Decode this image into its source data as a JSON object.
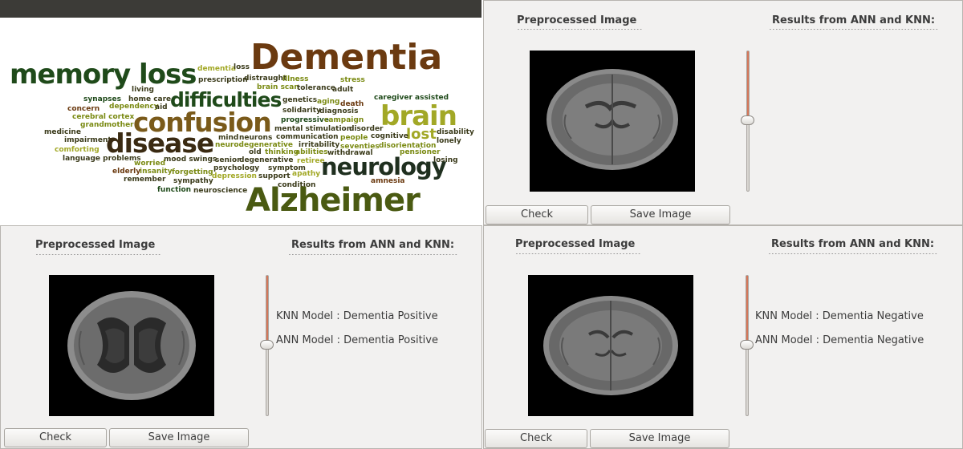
{
  "wordcloud": {
    "words": {
      "dementia": "Dementia",
      "memory_loss": "memory loss",
      "difficulties": "difficulties",
      "confusion": "confusion",
      "disease": "disease",
      "brain": "brain",
      "lost": "lost",
      "neurology": "neurology",
      "alzheimer": "Alzheimer",
      "dementia_small": "dementia",
      "loss": "loss",
      "prescription": "prescription",
      "distraught": "distraught",
      "illness": "illness",
      "stress": "stress",
      "brain_scan": "brain scan",
      "tolerance": "tolerance",
      "adult": "adult",
      "living": "living",
      "synapses": "synapses",
      "home_care": "home care",
      "caregiver_assisted": "caregiver assisted",
      "genetics": "genetics",
      "aging": "aging",
      "death": "death",
      "concern": "concern",
      "dependency": "dependency",
      "aid": "aid",
      "cerebral_cortex": "cerebral cortex",
      "solidarity": "solidarity",
      "diagnosis": "diagnosis",
      "grandmother": "grandmother",
      "progressive": "progressive",
      "campaign": "campaign",
      "medicine": "medicine",
      "mental_stimulation": "mental stimulation",
      "disorder": "disorder",
      "cognitive": "cognitive",
      "disability": "disability",
      "impairment": "impairment",
      "mind": "mind",
      "neurons": "neurons",
      "communication": "communication",
      "people": "people",
      "lonely": "lonely",
      "neurodegenerative": "neurodegenerative",
      "irritability": "irritability",
      "seventies": "seventies",
      "disorientation": "disorientation",
      "comforting": "comforting",
      "old": "old",
      "thinking": "thinking",
      "abilities": "abilities",
      "withdrawal": "withdrawal",
      "pensioner": "pensioner",
      "language_problems": "language problems",
      "mood_swings": "mood swings",
      "senior": "senior",
      "degenerative": "degenerative",
      "retiree": "retiree",
      "losing": "losing",
      "worried": "worried",
      "psychology": "psychology",
      "symptom": "symptom",
      "elderly": "elderly",
      "insanity": "insanity",
      "forgetting": "forgetting",
      "depression": "depression",
      "apathy": "apathy",
      "remember": "remember",
      "support": "support",
      "amnesia": "amnesia",
      "sympathy": "sympathy",
      "condition": "condition",
      "function": "function",
      "neuroscience": "neuroscience"
    }
  },
  "panels": [
    {
      "preprocessed_title": "Preprocessed Image",
      "preprocessed_underline": "----------------------------------------",
      "results_title": "Results from ANN and KNN:",
      "results_underline": "------------------------------------------------------",
      "knn_result": "",
      "ann_result": "",
      "check_label": "Check",
      "save_label": "Save Image"
    },
    {
      "preprocessed_title": "Preprocessed Image",
      "preprocessed_underline": "----------------------------------------",
      "results_title": "Results from ANN and KNN:",
      "results_underline": "------------------------------------------------------",
      "knn_result": "KNN Model : Dementia Positive",
      "ann_result": "ANN Model : Dementia Positive",
      "check_label": "Check",
      "save_label": "Save Image"
    },
    {
      "preprocessed_title": "Preprocessed Image",
      "preprocessed_underline": "----------------------------------------",
      "results_title": "Results from ANN and KNN:",
      "results_underline": "------------------------------------------------------",
      "knn_result": "KNN Model : Dementia Negative",
      "ann_result": "ANN Model : Dementia Negative",
      "check_label": "Check",
      "save_label": "Save Image"
    }
  ],
  "colors": {
    "wordcloud_brown": "#6b3a10",
    "wordcloud_dark_green": "#1f4a1a",
    "wordcloud_olive": "#7a8a12",
    "wordcloud_light_olive": "#a2a826",
    "slider_fill": "#d4775a",
    "panel_background": "#f2f1f0"
  },
  "icons": {
    "slider_knob": "slider-knob-icon"
  }
}
